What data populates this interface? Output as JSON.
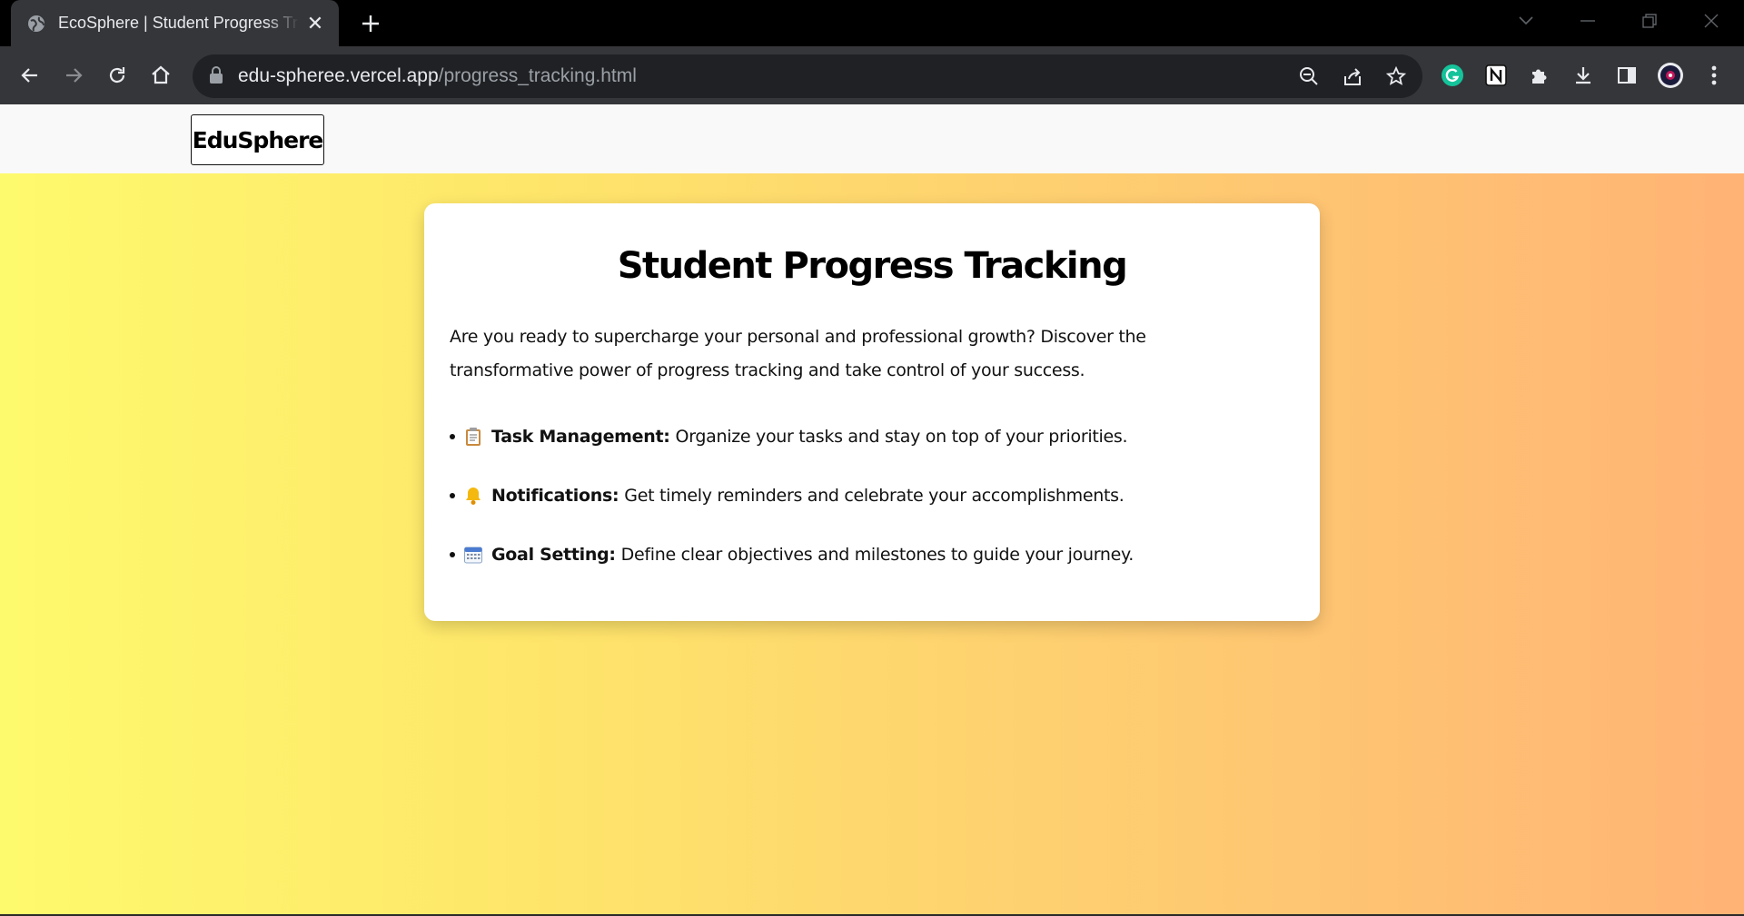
{
  "browser": {
    "tab_title": "EcoSphere | Student Progress Tracking",
    "url_host": "edu-spheree.vercel.app",
    "url_path": "/progress_tracking.html"
  },
  "site": {
    "logo_text": "EduSphere"
  },
  "card": {
    "title": "Student Progress Tracking",
    "intro": "Are you ready to supercharge your personal and professional growth? Discover the transformative power of progress tracking and take control of your success.",
    "features": [
      {
        "icon": "clipboard-icon",
        "name": "Task Management:",
        "description": "Organize your tasks and stay on top of your priorities."
      },
      {
        "icon": "bell-icon",
        "name": "Notifications:",
        "description": "Get timely reminders and celebrate your accomplishments."
      },
      {
        "icon": "calendar-icon",
        "name": "Goal Setting:",
        "description": "Define clear objectives and milestones to guide your journey."
      }
    ]
  },
  "colors": {
    "gradient_start": "#fefa6d",
    "gradient_end": "#ffb375",
    "chrome_dark": "#35363a",
    "grammarly_green": "#15c39a"
  }
}
